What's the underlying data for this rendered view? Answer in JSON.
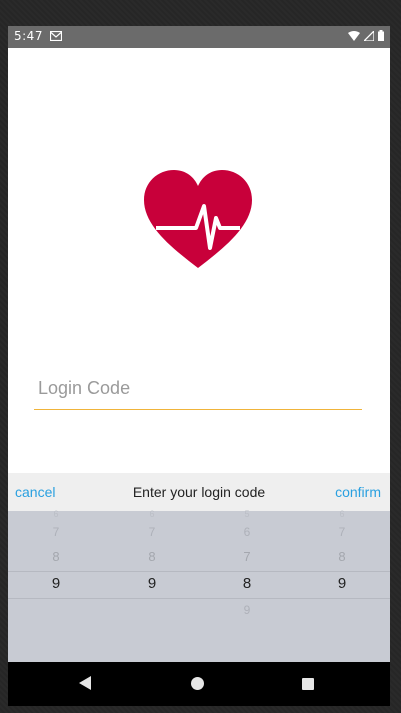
{
  "status_bar": {
    "time": "5:47"
  },
  "login_form": {
    "placeholder": "Login Code",
    "value": ""
  },
  "picker": {
    "cancel_label": "cancel",
    "title": "Enter your login code",
    "confirm_label": "confirm",
    "columns": [
      {
        "above": [
          "6",
          "7",
          "8"
        ],
        "selected": "9",
        "below": []
      },
      {
        "above": [
          "6",
          "7",
          "8"
        ],
        "selected": "9",
        "below": []
      },
      {
        "above": [
          "5",
          "6",
          "7"
        ],
        "selected": "8",
        "below": [
          "9"
        ]
      },
      {
        "above": [
          "6",
          "7",
          "8"
        ],
        "selected": "9",
        "below": []
      }
    ]
  },
  "colors": {
    "accent": "#2aa0e0",
    "heart": "#c8003a",
    "input_underline": "#f0b43a"
  }
}
